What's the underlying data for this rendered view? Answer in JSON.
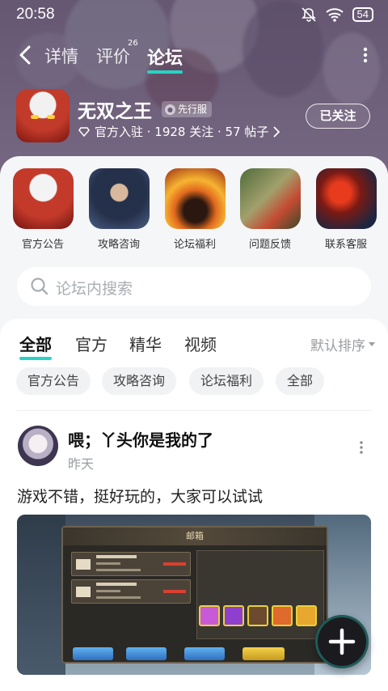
{
  "status_bar": {
    "time": "20:58",
    "battery": "54"
  },
  "nav": {
    "tabs": [
      {
        "label": "详情"
      },
      {
        "label": "评价",
        "count": "26"
      },
      {
        "label": "论坛"
      }
    ],
    "active_tab": "论坛"
  },
  "game": {
    "title": "无双之王",
    "badge": "先行服",
    "meta": "官方入驻 · 1928 关注 · 57 帖子",
    "follow_label": "已关注"
  },
  "quick_links": [
    {
      "label": "官方公告"
    },
    {
      "label": "攻略咨询"
    },
    {
      "label": "论坛福利"
    },
    {
      "label": "问题反馈"
    },
    {
      "label": "联系客服"
    }
  ],
  "search": {
    "placeholder": "论坛内搜索"
  },
  "filter_tabs": [
    {
      "label": "全部"
    },
    {
      "label": "官方"
    },
    {
      "label": "精华"
    },
    {
      "label": "视频"
    }
  ],
  "sort_label": "默认排序",
  "chips": [
    {
      "label": "官方公告"
    },
    {
      "label": "攻略咨询"
    },
    {
      "label": "论坛福利"
    },
    {
      "label": "全部"
    }
  ],
  "post": {
    "title": "喂；丫头你是我的了",
    "time": "昨天",
    "body": "游戏不错，挺好玩的，大家可以试试",
    "image_window_title": "邮箱"
  },
  "colors": {
    "accent": "#27d3c4",
    "header_bg": "#7b6a86",
    "fab": "#1b1b1f"
  }
}
